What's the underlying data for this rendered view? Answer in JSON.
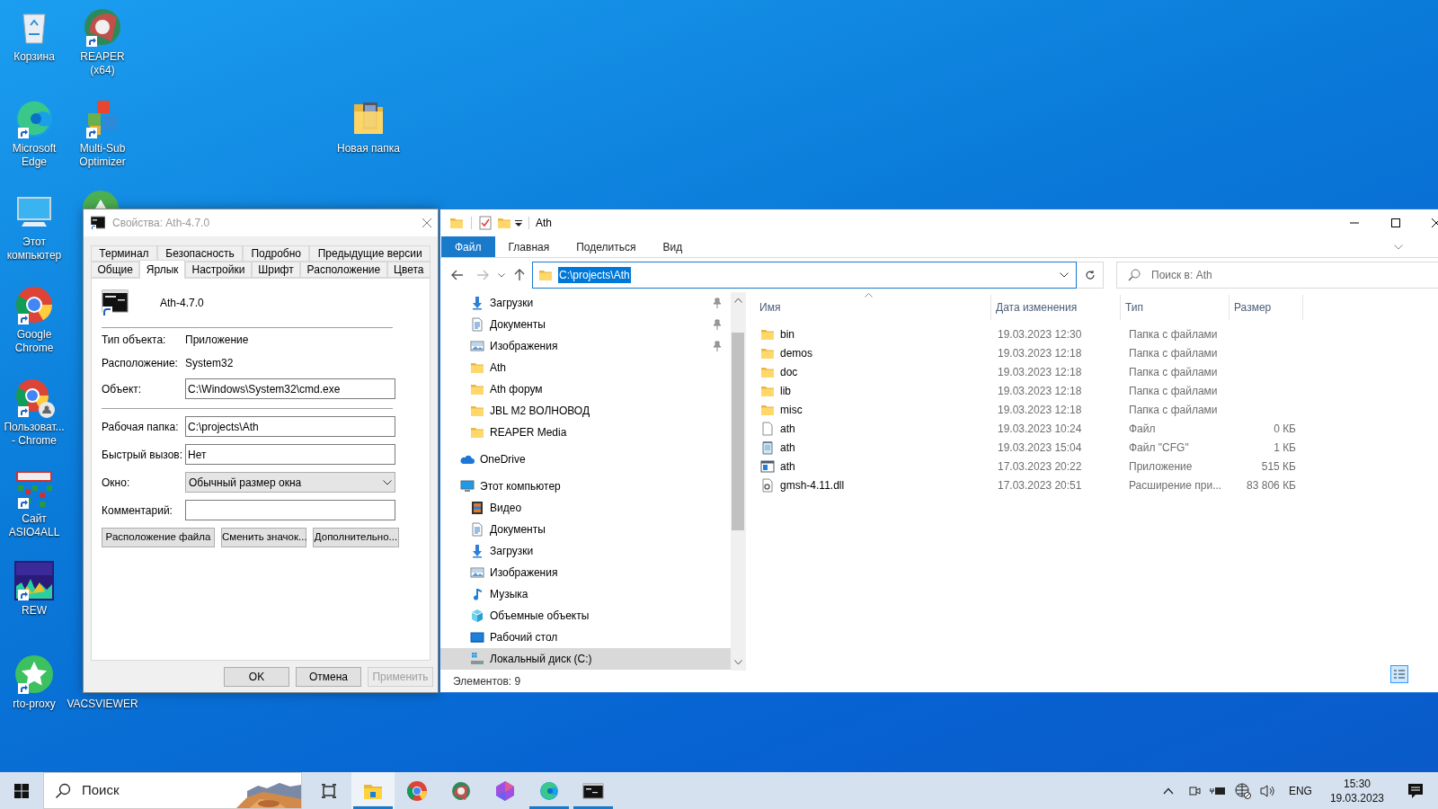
{
  "desktop_icons": [
    {
      "label": "Корзина",
      "kind": "recycle-bin",
      "shortcut": false
    },
    {
      "label": "REAPER (x64)",
      "kind": "reaper",
      "shortcut": true
    },
    {
      "label": "Microsoft Edge",
      "kind": "edge",
      "shortcut": true
    },
    {
      "label": "Multi-Sub Optimizer",
      "kind": "multisub",
      "shortcut": true
    },
    {
      "label": "Новая папка",
      "kind": "folder",
      "shortcut": false
    },
    {
      "label": "Этот компьютер",
      "kind": "computer",
      "shortcut": false
    },
    {
      "label": "Google Chrome",
      "kind": "chrome",
      "shortcut": true
    },
    {
      "label": "Пользоват... - Chrome",
      "kind": "chrome-profile",
      "shortcut": true
    },
    {
      "label": "Сайт ASIO4ALL",
      "kind": "asio",
      "shortcut": true
    },
    {
      "label": "REW",
      "kind": "rew",
      "shortcut": true
    },
    {
      "label": "rto-proxy",
      "kind": "star",
      "shortcut": true
    },
    {
      "label": "VACSVIEWER",
      "kind": "covered"
    }
  ],
  "properties_dialog": {
    "title": "Свойства: Ath-4.7.0",
    "tab_rows": [
      [
        {
          "label": "Терминал",
          "selected": false
        },
        {
          "label": "Безопасность",
          "selected": false
        },
        {
          "label": "Подробно",
          "selected": false
        },
        {
          "label": "Предыдущие версии",
          "selected": false
        }
      ],
      [
        {
          "label": "Общие",
          "selected": false
        },
        {
          "label": "Ярлык",
          "selected": true
        },
        {
          "label": "Настройки",
          "selected": false
        },
        {
          "label": "Шрифт",
          "selected": false
        },
        {
          "label": "Расположение",
          "selected": false
        },
        {
          "label": "Цвета",
          "selected": false
        }
      ]
    ],
    "shortcut_name": "Ath-4.7.0",
    "info": [
      {
        "label": "Тип объекта:",
        "value": "Приложение"
      },
      {
        "label": "Расположение:",
        "value": "System32"
      }
    ],
    "target": {
      "label": "Объект:",
      "value": "C:\\Windows\\System32\\cmd.exe"
    },
    "fields": [
      {
        "label": "Рабочая папка:",
        "value": "C:\\projects\\Ath",
        "kind": "text"
      },
      {
        "label": "Быстрый вызов:",
        "value": "Нет",
        "kind": "text"
      },
      {
        "label": "Окно:",
        "value": "Обычный размер окна",
        "kind": "dropdown"
      },
      {
        "label": "Комментарий:",
        "kind": "text"
      }
    ],
    "buttons": [
      "Расположение файла",
      "Сменить значок...",
      "Дополнительно..."
    ],
    "footer_buttons": [
      {
        "label": "OK",
        "disabled": false
      },
      {
        "label": "Отмена",
        "disabled": false
      },
      {
        "label": "Применить",
        "disabled": true
      }
    ]
  },
  "explorer": {
    "title": "Ath",
    "ribbon_tabs": [
      {
        "label": "Файл",
        "kind": "menu"
      },
      {
        "label": "Главная",
        "kind": "tab"
      },
      {
        "label": "Поделиться",
        "kind": "tab"
      },
      {
        "label": "Вид",
        "kind": "tab"
      }
    ],
    "address": {
      "text": "C:\\projects\\Ath",
      "selected": true
    },
    "search_placeholder": "Поиск в: Ath",
    "quick_access": [
      {
        "label": "Загрузки",
        "kind": "downloads",
        "pinned": true,
        "selected": false
      },
      {
        "label": "Документы",
        "kind": "documents",
        "pinned": true,
        "selected": false
      },
      {
        "label": "Изображения",
        "kind": "pictures",
        "pinned": true,
        "selected": false
      },
      {
        "label": "Ath",
        "kind": "folder",
        "pinned": false,
        "selected": false
      },
      {
        "label": "Ath форум",
        "kind": "folder",
        "pinned": false,
        "selected": false
      },
      {
        "label": "JBL M2 ВОЛНОВОД",
        "kind": "folder",
        "pinned": false,
        "selected": false
      },
      {
        "label": "REAPER Media",
        "kind": "folder",
        "pinned": false,
        "selected": false
      }
    ],
    "locations": [
      {
        "label": "OneDrive",
        "kind": "onedrive",
        "selected": false
      },
      {
        "label": "Этот компьютер",
        "kind": "computer",
        "selected": false,
        "children": [
          {
            "label": "Видео",
            "kind": "video",
            "selected": false
          },
          {
            "label": "Документы",
            "kind": "documents",
            "selected": false
          },
          {
            "label": "Загрузки",
            "kind": "downloads",
            "selected": false
          },
          {
            "label": "Изображения",
            "kind": "pictures",
            "selected": false
          },
          {
            "label": "Музыка",
            "kind": "music",
            "selected": false
          },
          {
            "label": "Объемные объекты",
            "kind": "cube",
            "selected": false
          },
          {
            "label": "Рабочий стол",
            "kind": "desktop",
            "selected": false
          },
          {
            "label": "Локальный диск (C:)",
            "kind": "drive",
            "selected": true
          }
        ]
      }
    ],
    "columns": [
      {
        "label": "Имя",
        "sorted": true
      },
      {
        "label": "Дата изменения",
        "sorted": false
      },
      {
        "label": "Тип",
        "sorted": false
      },
      {
        "label": "Размер",
        "sorted": false
      }
    ],
    "rows": [
      {
        "name": "bin",
        "date": "19.03.2023 12:30",
        "type": "Папка с файлами",
        "kind": "folder"
      },
      {
        "name": "demos",
        "date": "19.03.2023 12:18",
        "type": "Папка с файлами",
        "kind": "folder"
      },
      {
        "name": "doc",
        "date": "19.03.2023 12:18",
        "type": "Папка с файлами",
        "kind": "folder"
      },
      {
        "name": "lib",
        "date": "19.03.2023 12:18",
        "type": "Папка с файлами",
        "kind": "folder"
      },
      {
        "name": "misc",
        "date": "19.03.2023 12:18",
        "type": "Папка с файлами",
        "kind": "folder"
      },
      {
        "name": "ath",
        "date": "19.03.2023 10:24",
        "type": "Файл",
        "size": "0 КБ",
        "kind": "file"
      },
      {
        "name": "ath",
        "date": "19.03.2023 15:04",
        "type": "Файл \"CFG\"",
        "size": "1 КБ",
        "kind": "cfg"
      },
      {
        "name": "ath",
        "date": "17.03.2023 20:22",
        "type": "Приложение",
        "size": "515 КБ",
        "kind": "app"
      },
      {
        "name": "gmsh-4.11.dll",
        "date": "17.03.2023 20:51",
        "type": "Расширение при...",
        "size": "83 806 КБ",
        "kind": "dll"
      }
    ],
    "status": "Элементов: 9"
  },
  "taskbar": {
    "search_placeholder": "Поиск",
    "apps": [
      {
        "kind": "explorer",
        "selected": true,
        "running": true
      },
      {
        "kind": "chrome",
        "selected": false,
        "running": false
      },
      {
        "kind": "reaper",
        "selected": false,
        "running": false
      },
      {
        "kind": "gem",
        "selected": false,
        "running": false
      },
      {
        "kind": "edge",
        "selected": false,
        "running": true
      },
      {
        "kind": "terminal",
        "selected": false,
        "running": true
      }
    ],
    "language": "ENG",
    "time": "15:30",
    "date": "19.03.2023"
  }
}
